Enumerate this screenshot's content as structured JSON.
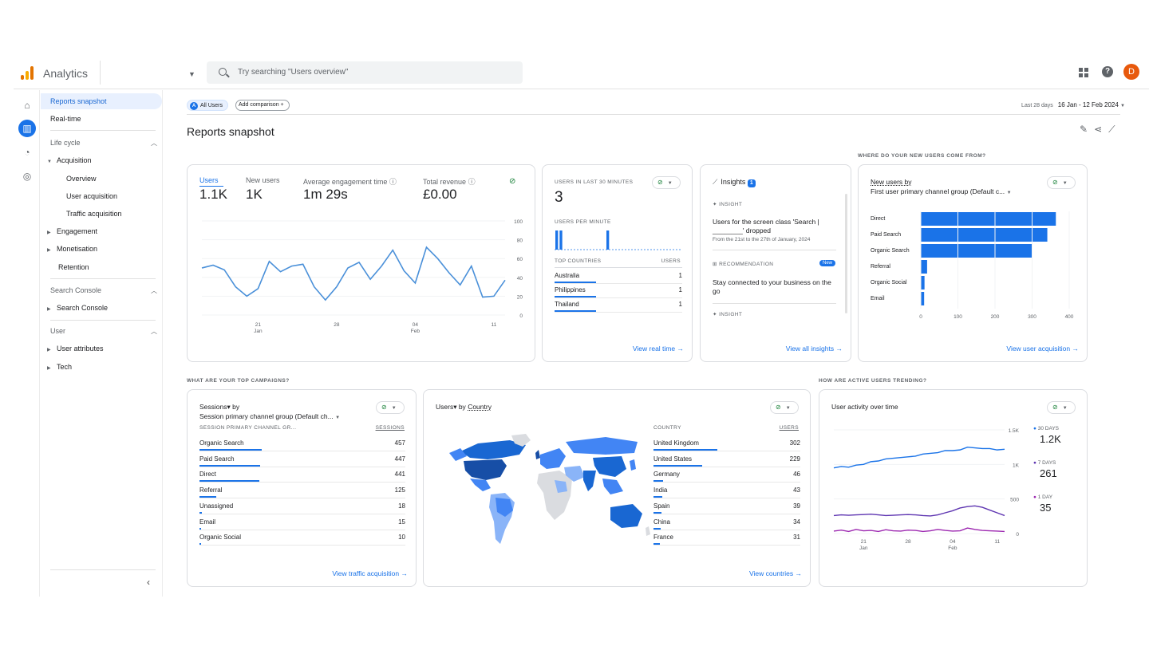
{
  "app": {
    "title": "Analytics",
    "search_placeholder": "Try searching \"Users overview\"",
    "avatar_letter": "D"
  },
  "nav": {
    "reports_snapshot": "Reports snapshot",
    "realtime": "Real-time",
    "lifecycle": "Life cycle",
    "acquisition": "Acquisition",
    "overview": "Overview",
    "user_acquisition": "User acquisition",
    "traffic_acquisition": "Traffic acquisition",
    "engagement": "Engagement",
    "monetisation": "Monetisation",
    "retention": "Retention",
    "search_console_section": "Search Console",
    "search_console": "Search Console",
    "user_section": "User",
    "user_attributes": "User attributes",
    "tech": "Tech"
  },
  "header": {
    "all_users": "All Users",
    "all_users_badge": "A",
    "add_comparison": "Add comparison",
    "date_label": "Last 28 days",
    "date_range": "16 Jan - 12 Feb 2024",
    "page_title": "Reports snapshot"
  },
  "sections": {
    "new_users_from": "WHERE DO YOUR NEW USERS COME FROM?",
    "top_campaigns": "WHAT ARE YOUR TOP CAMPAIGNS?",
    "active_trending": "HOW ARE ACTIVE USERS TRENDING?"
  },
  "metrics": {
    "users_label": "Users",
    "users_value": "1.1K",
    "new_users_label": "New users",
    "new_users_value": "1K",
    "engagement_label": "Average engagement time",
    "engagement_value": "1m 29s",
    "revenue_label": "Total revenue",
    "revenue_value": "£0.00"
  },
  "realtime": {
    "title": "USERS IN LAST 30 MINUTES",
    "value": "3",
    "per_minute": "USERS PER MINUTE",
    "countries_header": "TOP COUNTRIES",
    "users_header": "USERS",
    "rows": [
      {
        "country": "Australia",
        "users": "1"
      },
      {
        "country": "Philippines",
        "users": "1"
      },
      {
        "country": "Thailand",
        "users": "1"
      }
    ],
    "link": "View real time"
  },
  "insights": {
    "title": "Insights",
    "count": "1",
    "insight_label": "INSIGHT",
    "insight_text": "Users for the screen class 'Search | ________' dropped",
    "insight_date": "From the 21st to the 27th of January, 2024",
    "rec_label": "RECOMMENDATION",
    "rec_badge": "New",
    "rec_text": "Stay connected to your business on the go",
    "insight_label_2": "INSIGHT",
    "link": "View all insights"
  },
  "new_users_card": {
    "title": "New users by",
    "subtitle": "First user primary channel group (Default c...",
    "link": "View user acquisition"
  },
  "campaigns": {
    "title": "Sessions▾ by",
    "subtitle": "Session primary channel group (Default ch...",
    "col1": "SESSION PRIMARY CHANNEL GR...",
    "col2": "SESSIONS",
    "rows": [
      {
        "name": "Organic Search",
        "value": "457",
        "frac": 1.0
      },
      {
        "name": "Paid Search",
        "value": "447",
        "frac": 0.98
      },
      {
        "name": "Direct",
        "value": "441",
        "frac": 0.96
      },
      {
        "name": "Referral",
        "value": "125",
        "frac": 0.27
      },
      {
        "name": "Unassigned",
        "value": "18",
        "frac": 0.04
      },
      {
        "name": "Email",
        "value": "15",
        "frac": 0.03
      },
      {
        "name": "Organic Social",
        "value": "10",
        "frac": 0.02
      }
    ],
    "link": "View traffic acquisition"
  },
  "country_card": {
    "title_prefix": "Users▾ by",
    "title_dim": "Country",
    "col1": "COUNTRY",
    "col2": "USERS",
    "rows": [
      {
        "name": "United Kingdom",
        "value": "302",
        "frac": 1.0
      },
      {
        "name": "United States",
        "value": "229",
        "frac": 0.76
      },
      {
        "name": "Germany",
        "value": "46",
        "frac": 0.15
      },
      {
        "name": "India",
        "value": "43",
        "frac": 0.14
      },
      {
        "name": "Spain",
        "value": "39",
        "frac": 0.13
      },
      {
        "name": "China",
        "value": "34",
        "frac": 0.11
      },
      {
        "name": "France",
        "value": "31",
        "frac": 0.1
      }
    ],
    "link": "View countries"
  },
  "activity": {
    "title": "User activity over time",
    "legend": [
      {
        "label": "30 DAYS",
        "value": "1.2K",
        "color": "#1a73e8"
      },
      {
        "label": "7 DAYS",
        "value": "261",
        "color": "#5e35b1"
      },
      {
        "label": "1 DAY",
        "value": "35",
        "color": "#9c27b0"
      }
    ]
  },
  "icons": {
    "home": "home-icon",
    "reports": "bar-chart-icon",
    "explore": "explore-icon",
    "advertising": "target-icon",
    "settings": "gear-icon"
  },
  "chart_data": [
    {
      "type": "line",
      "title": "",
      "x_ticks": [
        "21\nJan",
        "28",
        "04\nFeb",
        "11"
      ],
      "ylim": [
        0,
        100
      ],
      "y_ticks": [
        0,
        20,
        40,
        60,
        80,
        100
      ],
      "series": [
        {
          "values": [
            50,
            53,
            48,
            30,
            20,
            28,
            57,
            46,
            52,
            54,
            30,
            16,
            30,
            50,
            56,
            38,
            52,
            69,
            47,
            34,
            72,
            60,
            45,
            32,
            52,
            19,
            20,
            37
          ]
        }
      ]
    },
    {
      "type": "bar",
      "title": "USERS PER MINUTE",
      "values": [
        1,
        1,
        0,
        0,
        0,
        0,
        0,
        0,
        0,
        0,
        0,
        0,
        1,
        0,
        0,
        0,
        0,
        0,
        0,
        0,
        0,
        0,
        0,
        0,
        0,
        0,
        0,
        0,
        0,
        0
      ]
    },
    {
      "type": "bar",
      "orientation": "horizontal",
      "categories": [
        "Direct",
        "Paid Search",
        "Organic Search",
        "Referral",
        "Organic Social",
        "Email"
      ],
      "values": [
        364,
        341,
        300,
        17,
        10,
        9
      ],
      "xlim": [
        0,
        400
      ],
      "x_ticks": [
        0,
        100,
        200,
        300,
        400
      ]
    },
    {
      "type": "line",
      "title": "User activity over time",
      "x_ticks": [
        "21\nJan",
        "28",
        "04\nFeb",
        "11"
      ],
      "ylim": [
        0,
        1500
      ],
      "y_ticks": [
        "0",
        "500",
        "1K",
        "1.5K"
      ],
      "series": [
        {
          "name": "30 DAYS",
          "values": [
            950,
            970,
            960,
            990,
            1000,
            1040,
            1050,
            1080,
            1090,
            1100,
            1110,
            1120,
            1150,
            1160,
            1170,
            1200,
            1200,
            1210,
            1250,
            1240,
            1230,
            1230,
            1210,
            1220
          ]
        },
        {
          "name": "7 DAYS",
          "values": [
            260,
            270,
            265,
            270,
            275,
            280,
            270,
            260,
            265,
            270,
            275,
            270,
            260,
            255,
            270,
            300,
            330,
            370,
            390,
            400,
            380,
            340,
            300,
            260
          ]
        },
        {
          "name": "1 DAY",
          "values": [
            35,
            50,
            30,
            60,
            40,
            45,
            30,
            55,
            40,
            35,
            50,
            45,
            30,
            40,
            60,
            45,
            35,
            40,
            80,
            60,
            45,
            40,
            35,
            30
          ]
        }
      ]
    }
  ]
}
